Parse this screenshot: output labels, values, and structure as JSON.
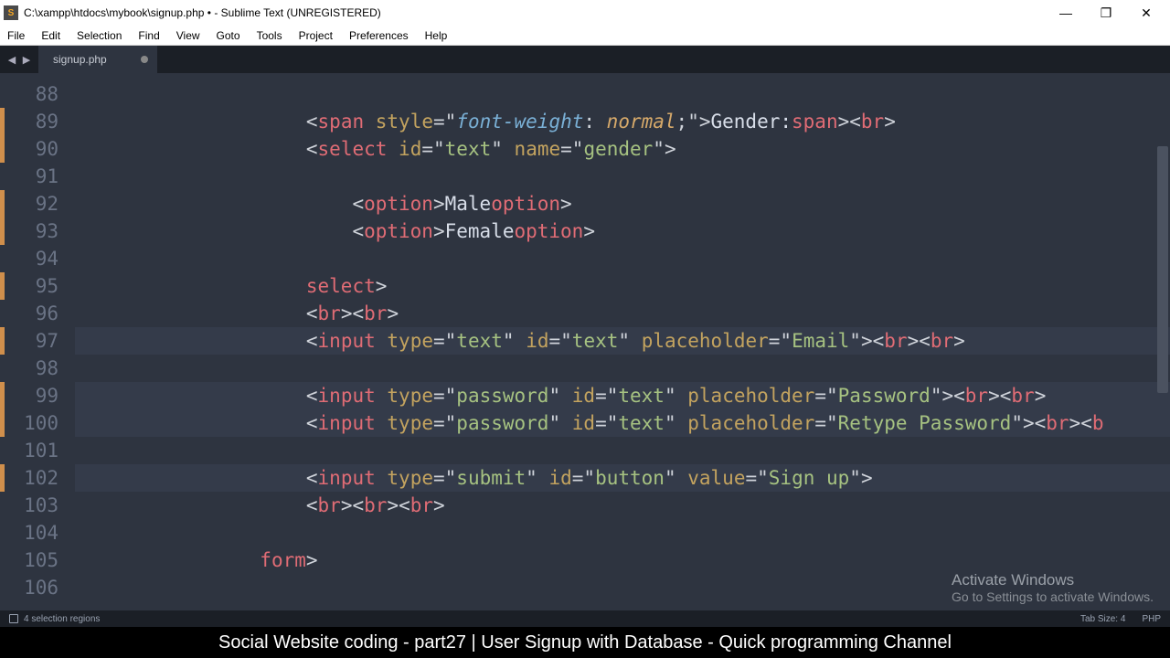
{
  "window": {
    "title": "C:\\xampp\\htdocs\\mybook\\signup.php • - Sublime Text (UNREGISTERED)",
    "app_icon_letter": "S"
  },
  "menubar": [
    "File",
    "Edit",
    "Selection",
    "Find",
    "View",
    "Goto",
    "Tools",
    "Project",
    "Preferences",
    "Help"
  ],
  "tab": {
    "label": "signup.php"
  },
  "gutter": {
    "lines": [
      {
        "n": "88",
        "mod": false
      },
      {
        "n": "89",
        "mod": true
      },
      {
        "n": "90",
        "mod": true
      },
      {
        "n": "91",
        "mod": false
      },
      {
        "n": "92",
        "mod": true
      },
      {
        "n": "93",
        "mod": true
      },
      {
        "n": "94",
        "mod": false
      },
      {
        "n": "95",
        "mod": true
      },
      {
        "n": "96",
        "mod": false
      },
      {
        "n": "97",
        "mod": true
      },
      {
        "n": "98",
        "mod": false
      },
      {
        "n": "99",
        "mod": true
      },
      {
        "n": "100",
        "mod": true
      },
      {
        "n": "101",
        "mod": false
      },
      {
        "n": "102",
        "mod": true
      },
      {
        "n": "103",
        "mod": false
      },
      {
        "n": "104",
        "mod": false
      },
      {
        "n": "105",
        "mod": false
      },
      {
        "n": "106",
        "mod": false
      }
    ]
  },
  "code": {
    "indent": "                    ",
    "indent2": "                        ",
    "l89": {
      "tag": "span",
      "attr": "style",
      "eq": "=",
      "q": "\"",
      "css_prop": "font-weight",
      "css_col": ": ",
      "css_val": "normal",
      "css_semi": ";",
      "text": "Gender:",
      "close": "span",
      "br": "br",
      "lt": "<",
      "gt": ">",
      "sl": "/"
    },
    "l90": {
      "tag": "select",
      "a1": "id",
      "v1": "text",
      "a2": "name",
      "v2": "gender",
      "lt": "<",
      "gt": ">",
      "q": "\"",
      "eq": "="
    },
    "l92": {
      "tag": "option",
      "text": "Male",
      "lt": "<",
      "gt": ">",
      "sl": "/"
    },
    "l93": {
      "tag": "option",
      "text": "Female",
      "lt": "<",
      "gt": ">",
      "sl": "/"
    },
    "l95": {
      "tag": "select",
      "lt": "<",
      "gt": ">",
      "sl": "/"
    },
    "l96": {
      "tag": "br",
      "lt": "<",
      "gt": ">"
    },
    "l97": {
      "tag": "input",
      "a1": "type",
      "v1": "text",
      "a2": "id",
      "v2": "text",
      "a3": "placeholder",
      "v3": "Email",
      "br": "br",
      "lt": "<",
      "gt": ">",
      "q": "\"",
      "eq": "="
    },
    "l99": {
      "tag": "input",
      "a1": "type",
      "v1": "password",
      "a2": "id",
      "v2": "text",
      "a3": "placeholder",
      "v3": "Password",
      "br": "br",
      "lt": "<",
      "gt": ">",
      "q": "\"",
      "eq": "="
    },
    "l100": {
      "tag": "input",
      "a1": "type",
      "v1": "password",
      "a2": "id",
      "v2": "text",
      "a3": "placeholder",
      "v3": "Retype Password",
      "br": "br",
      "b": "b",
      "lt": "<",
      "gt": ">",
      "q": "\"",
      "eq": "="
    },
    "l102": {
      "tag": "input",
      "a1": "type",
      "v1": "submit",
      "a2": "id",
      "v2": "button",
      "a3": "value",
      "v3": "Sign up",
      "lt": "<",
      "gt": ">",
      "q": "\"",
      "eq": "="
    },
    "l103": {
      "tag": "br",
      "lt": "<",
      "gt": ">"
    },
    "l105": {
      "tag": "form",
      "lt": "<",
      "gt": ">",
      "sl": "/",
      "indent": "                "
    }
  },
  "statusbar": {
    "left": "4 selection regions",
    "tab_size": "Tab Size: 4",
    "lang": "PHP"
  },
  "watermark": {
    "title": "Activate Windows",
    "sub": "Go to Settings to activate Windows."
  },
  "caption": "Social Website coding - part27 | User Signup with Database - Quick programming Channel"
}
